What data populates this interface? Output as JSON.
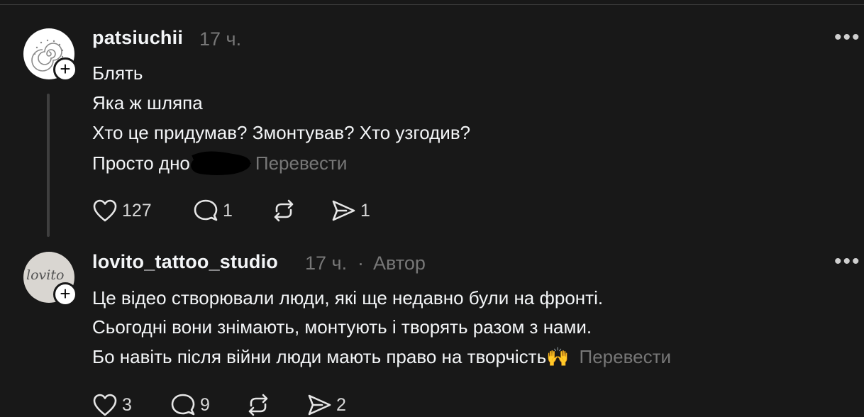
{
  "posts": [
    {
      "username": "patsiuchii",
      "time": "17 ч.",
      "lines": [
        "Блять",
        "Яка ж шляпа",
        "Хто це придумав? Змонтував? Хто узгодив?",
        "Просто дно"
      ],
      "translate": "Перевести",
      "likes": "127",
      "replies": "1",
      "shares": "1"
    },
    {
      "username": "lovito_tattoo_studio",
      "time": "17 ч.",
      "separator": "·",
      "badge": "Автор",
      "avatar_text": "lovito",
      "lines": [
        "Це відео створювали люди, які ще недавно були на фронті.",
        "Сьогодні вони знімають, монтують і творять разом з нами.",
        "Бо навіть після війни люди мають право на творчість🙌"
      ],
      "translate": "Перевести",
      "likes": "3",
      "replies": "9",
      "shares": "2"
    }
  ],
  "icons": {
    "more": "more-dots-icon",
    "like": "heart-icon",
    "reply": "comment-icon",
    "repost": "repost-icon",
    "share": "send-icon",
    "follow": "plus-icon"
  }
}
